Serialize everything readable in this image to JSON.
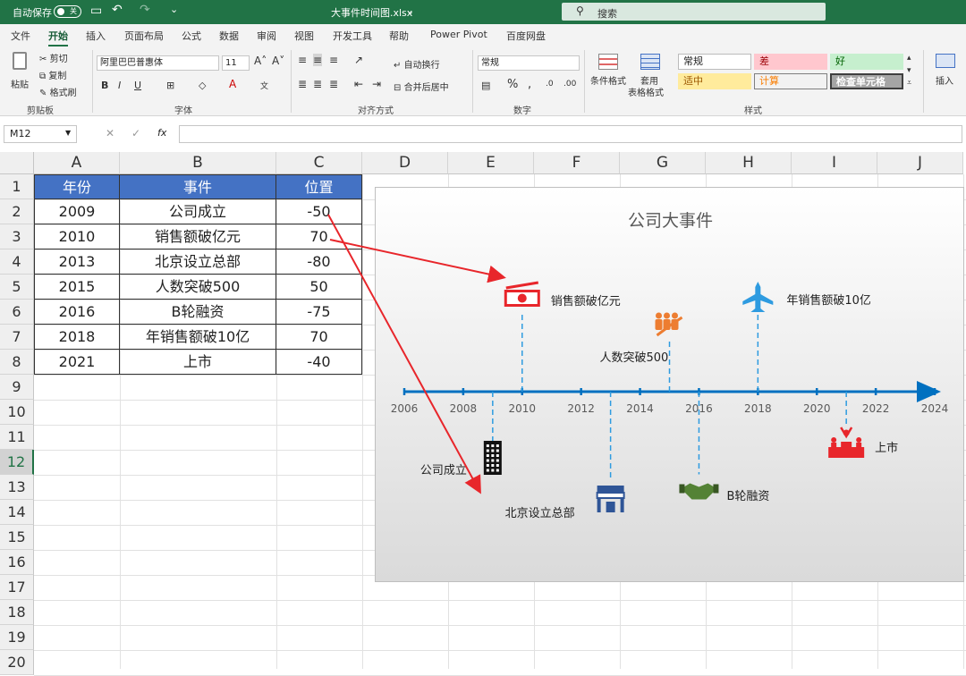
{
  "titlebar": {
    "autosave_label": "自动保存",
    "autosave_state": "关",
    "filename": "大事件时间图.xlsx",
    "search_placeholder": "搜索"
  },
  "menu": [
    "文件",
    "开始",
    "插入",
    "页面布局",
    "公式",
    "数据",
    "审阅",
    "视图",
    "开发工具",
    "帮助",
    "Power Pivot",
    "百度网盘"
  ],
  "active_menu": "开始",
  "ribbon": {
    "paste": "粘贴",
    "cut": "剪切",
    "copy": "复制",
    "format_painter": "格式刷",
    "group_clipboard": "剪贴板",
    "font_name": "阿里巴巴普惠体",
    "font_size": "11",
    "group_font": "字体",
    "wrap": "自动换行",
    "merge": "合并后居中",
    "group_align": "对齐方式",
    "num_format": "常规",
    "group_number": "数字",
    "cond_format": "条件格式",
    "table_format_1": "套用",
    "table_format_2": "表格格式",
    "styles": [
      "常规",
      "差",
      "好",
      "适中",
      "计算",
      "检查单元格"
    ],
    "group_styles": "样式",
    "insert": "插入"
  },
  "formula": {
    "namebox": "M12",
    "fx": "fx"
  },
  "columns": [
    "A",
    "B",
    "C",
    "D",
    "E",
    "F",
    "G",
    "H",
    "I",
    "J"
  ],
  "rows": [
    "1",
    "2",
    "3",
    "4",
    "5",
    "6",
    "7",
    "8",
    "9",
    "10",
    "11",
    "12",
    "13",
    "14",
    "15",
    "16",
    "17",
    "18",
    "19",
    "20"
  ],
  "selected_row": "12",
  "table": {
    "headers": [
      "年份",
      "事件",
      "位置"
    ],
    "rows": [
      [
        "2009",
        "公司成立",
        "-50"
      ],
      [
        "2010",
        "销售额破亿元",
        "70"
      ],
      [
        "2013",
        "北京设立总部",
        "-80"
      ],
      [
        "2015",
        "人数突破500",
        "50"
      ],
      [
        "2016",
        "B轮融资",
        "-75"
      ],
      [
        "2018",
        "年销售额破10亿",
        "70"
      ],
      [
        "2021",
        "上市",
        "-40"
      ]
    ]
  },
  "chart_data": {
    "type": "scatter",
    "title": "公司大事件",
    "xlim": [
      2006,
      2024
    ],
    "ylim": [
      -100,
      100
    ],
    "x_ticks": [
      "2006",
      "2008",
      "2010",
      "2012",
      "2014",
      "2016",
      "2018",
      "2020",
      "2022",
      "2024"
    ],
    "points": [
      {
        "x": 2009,
        "y": -50,
        "label": "公司成立",
        "icon": "building-icon"
      },
      {
        "x": 2010,
        "y": 70,
        "label": "销售额破亿元",
        "icon": "money-icon"
      },
      {
        "x": 2013,
        "y": -80,
        "label": "北京设立总部",
        "icon": "store-icon"
      },
      {
        "x": 2015,
        "y": 50,
        "label": "人数突破500",
        "icon": "people-growth-icon"
      },
      {
        "x": 2016,
        "y": -75,
        "label": "B轮融资",
        "icon": "handshake-icon"
      },
      {
        "x": 2018,
        "y": 70,
        "label": "年销售额破10亿",
        "icon": "airplane-icon"
      },
      {
        "x": 2021,
        "y": -40,
        "label": "上市",
        "icon": "podium-icon"
      }
    ],
    "axis_color": "#0070c0",
    "leader_color": "#2e9be0",
    "arrow_color": "#e8262b"
  }
}
